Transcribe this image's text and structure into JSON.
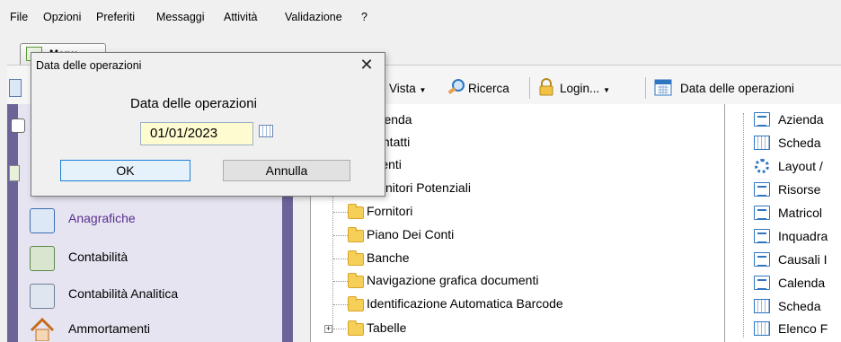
{
  "menubar": {
    "items": [
      "File",
      "Opzioni",
      "Preferiti",
      "Messaggi",
      "Attività",
      "Validazione",
      "?"
    ]
  },
  "tab": {
    "label": "Menu"
  },
  "toolbar": {
    "vista": "Vista",
    "ricerca": "Ricerca",
    "login": "Login...",
    "data_operazioni": "Data delle operazioni"
  },
  "sidebar": {
    "items": [
      {
        "label": "Anagrafiche",
        "icon": "people-card-icon"
      },
      {
        "label": "Contabilità",
        "icon": "calculator-money-icon"
      },
      {
        "label": "Contabilità Analitica",
        "icon": "calculator-chart-icon"
      },
      {
        "label": "Ammortamenti",
        "icon": "house-icon"
      }
    ]
  },
  "tree": {
    "items": [
      "Azienda",
      "Contatti",
      "Clienti",
      "Fornitori Potenziali",
      "Fornitori",
      "Piano Dei Conti",
      "Banche",
      "Navigazione grafica documenti",
      "Identificazione Automatica Barcode",
      "Tabelle"
    ],
    "expander": "+"
  },
  "right_tree": {
    "items": [
      {
        "label": "Azienda",
        "icon": "form-icon"
      },
      {
        "label": "Scheda",
        "icon": "grid-icon"
      },
      {
        "label": "Layout /",
        "icon": "gear-icon"
      },
      {
        "label": "Risorse",
        "icon": "form-icon"
      },
      {
        "label": "Matricol",
        "icon": "form-icon"
      },
      {
        "label": "Inquadra",
        "icon": "form-icon"
      },
      {
        "label": "Causali I",
        "icon": "form-icon"
      },
      {
        "label": "Calenda",
        "icon": "form-icon"
      },
      {
        "label": "Scheda",
        "icon": "grid-icon"
      },
      {
        "label": "Elenco F",
        "icon": "grid-icon"
      }
    ]
  },
  "dialog": {
    "title": "Data delle operazioni",
    "close": "✕",
    "heading": "Data delle operazioni",
    "date_value": "01/01/2023",
    "ok": "OK",
    "cancel": "Annulla"
  }
}
